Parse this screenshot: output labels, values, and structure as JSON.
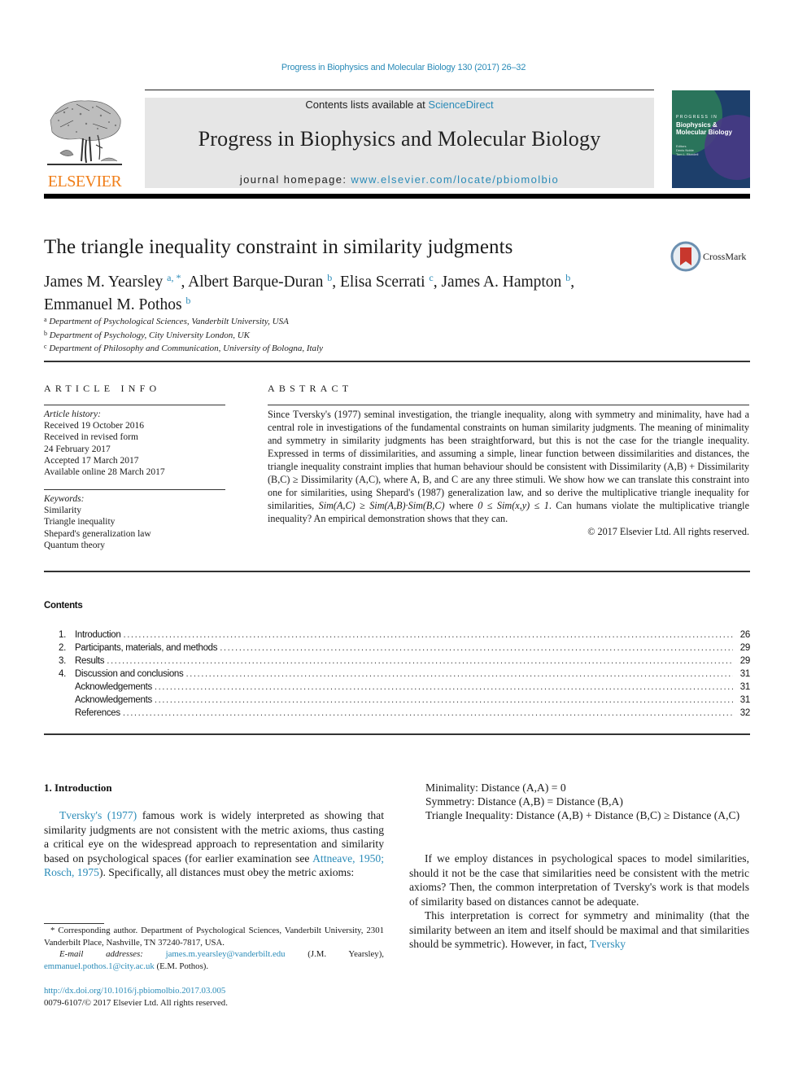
{
  "running_head": "Progress in Biophysics and Molecular Biology 130 (2017) 26–32",
  "masthead": {
    "contents_prefix": "Contents lists available at ",
    "contents_link": "ScienceDirect",
    "journal_title": "Progress in Biophysics and Molecular Biology",
    "homepage_prefix": "journal homepage: ",
    "homepage_link": "www.elsevier.com/locate/pbiomolbio",
    "publisher_logo": "ELSEVIER",
    "cover": {
      "line1": "PROGRESS IN",
      "line2": "Biophysics &",
      "line3": "Molecular Biology",
      "editors_label": "Editors",
      "editor1": "Denis Noble",
      "editor2": "Tom L. Blundell"
    }
  },
  "article": {
    "title": "The triangle inequality constraint in similarity judgments",
    "crossmark_label": "CrossMark",
    "authors": [
      {
        "name": "James M. Yearsley",
        "sup": "a, *",
        "sep": ", "
      },
      {
        "name": "Albert Barque-Duran",
        "sup": "b",
        "sep": ", "
      },
      {
        "name": "Elisa Scerrati",
        "sup": "c",
        "sep": ", "
      },
      {
        "name": "James A. Hampton",
        "sup": "b",
        "sep": ","
      },
      {
        "name": "Emmanuel M. Pothos",
        "sup": "b",
        "sep": ""
      }
    ],
    "affiliations": [
      {
        "key": "a",
        "text": "Department of Psychological Sciences, Vanderbilt University, USA"
      },
      {
        "key": "b",
        "text": "Department of Psychology, City University London, UK"
      },
      {
        "key": "c",
        "text": "Department of Philosophy and Communication, University of Bologna, Italy"
      }
    ]
  },
  "article_info": {
    "heading": "ARTICLE INFO",
    "history_label": "Article history:",
    "history": [
      "Received 19 October 2016",
      "Received in revised form",
      "24 February 2017",
      "Accepted 17 March 2017",
      "Available online 28 March 2017"
    ],
    "keywords_label": "Keywords:",
    "keywords": [
      "Similarity",
      "Triangle inequality",
      "Shepard's generalization law",
      "Quantum theory"
    ]
  },
  "abstract": {
    "heading": "ABSTRACT",
    "text_part1": "Since Tversky's (1977) seminal investigation, the triangle inequality, along with symmetry and minimality, have had a central role in investigations of the fundamental constraints on human similarity judgments. The meaning of minimality and symmetry in similarity judgments has been straightforward, but this is not the case for the triangle inequality. Expressed in terms of dissimilarities, and assuming a simple, linear function between dissimilarities and distances, the triangle inequality constraint implies that human behaviour should be consistent with Dissimilarity (A,B) + Dissimilarity (B,C) ≥ Dissimilarity (A,C), where A, B, and C are any three stimuli. We show how we can translate this constraint into one for similarities, using Shepard's (1987) generalization law, and so derive the multiplicative triangle inequality for similarities, ",
    "math1": "Sim(A,C) ≥ Sim(A,B)·Sim(B,C)",
    "text_part2": " where ",
    "math2": "0 ≤ Sim(x,y) ≤ 1",
    "text_part3": ". Can humans violate the multiplicative triangle inequality? An empirical demonstration shows that they can.",
    "copyright": "© 2017 Elsevier Ltd. All rights reserved."
  },
  "contents": {
    "heading": "Contents",
    "items": [
      {
        "num": "1.",
        "label": "Introduction",
        "page": "26"
      },
      {
        "num": "2.",
        "label": "Participants, materials, and methods",
        "page": "29"
      },
      {
        "num": "3.",
        "label": "Results",
        "page": "29"
      },
      {
        "num": "4.",
        "label": "Discussion and conclusions",
        "page": "31"
      },
      {
        "num": "",
        "label": "Acknowledgements",
        "page": "31"
      },
      {
        "num": "",
        "label": "Acknowledgements",
        "page": "31"
      },
      {
        "num": "",
        "label": "References",
        "page": "32"
      }
    ]
  },
  "introduction": {
    "heading": "1.  Introduction",
    "p1_link1": "Tversky's (1977)",
    "p1_text1": " famous work is widely interpreted as showing that similarity judgments are not consistent with the metric axioms, thus casting a critical eye on the widespread approach to representation and similarity based on psychological spaces (for earlier examination see ",
    "p1_link2": "Attneave, 1950; Rosch, 1975",
    "p1_text2": "). Specifically, all distances must obey the metric axioms:",
    "axioms": [
      "Minimality: Distance (A,A) = 0",
      "Symmetry: Distance (A,B) = Distance (B,A)",
      "Triangle Inequality: Distance (A,B) + Distance (B,C) ≥ Distance (A,C)"
    ],
    "p2": "If we employ distances in psychological spaces to model similarities, should it not be the case that similarities need be consistent with the metric axioms? Then, the common interpretation of Tversky's work is that models of similarity based on distances cannot be adequate.",
    "p3_text": "This interpretation is correct for symmetry and minimality (that the similarity between an item and itself should be maximal and that similarities should be symmetric). However, in fact, ",
    "p3_link": "Tversky"
  },
  "footnote": {
    "corresponding": "* Corresponding author. Department of Psychological Sciences, Vanderbilt University, 2301 Vanderbilt Place, Nashville, TN 37240-7817, USA.",
    "email_label": "E-mail addresses:",
    "email1": "james.m.yearsley@vanderbilt.edu",
    "email1_owner": " (J.M. Yearsley), ",
    "email2": "emmanuel.pothos.1@city.ac.uk",
    "email2_owner": " (E.M. Pothos).",
    "doi": "http://dx.doi.org/10.1016/j.pbiomolbio.2017.03.005",
    "issn_copyright": "0079-6107/© 2017 Elsevier Ltd. All rights reserved."
  }
}
